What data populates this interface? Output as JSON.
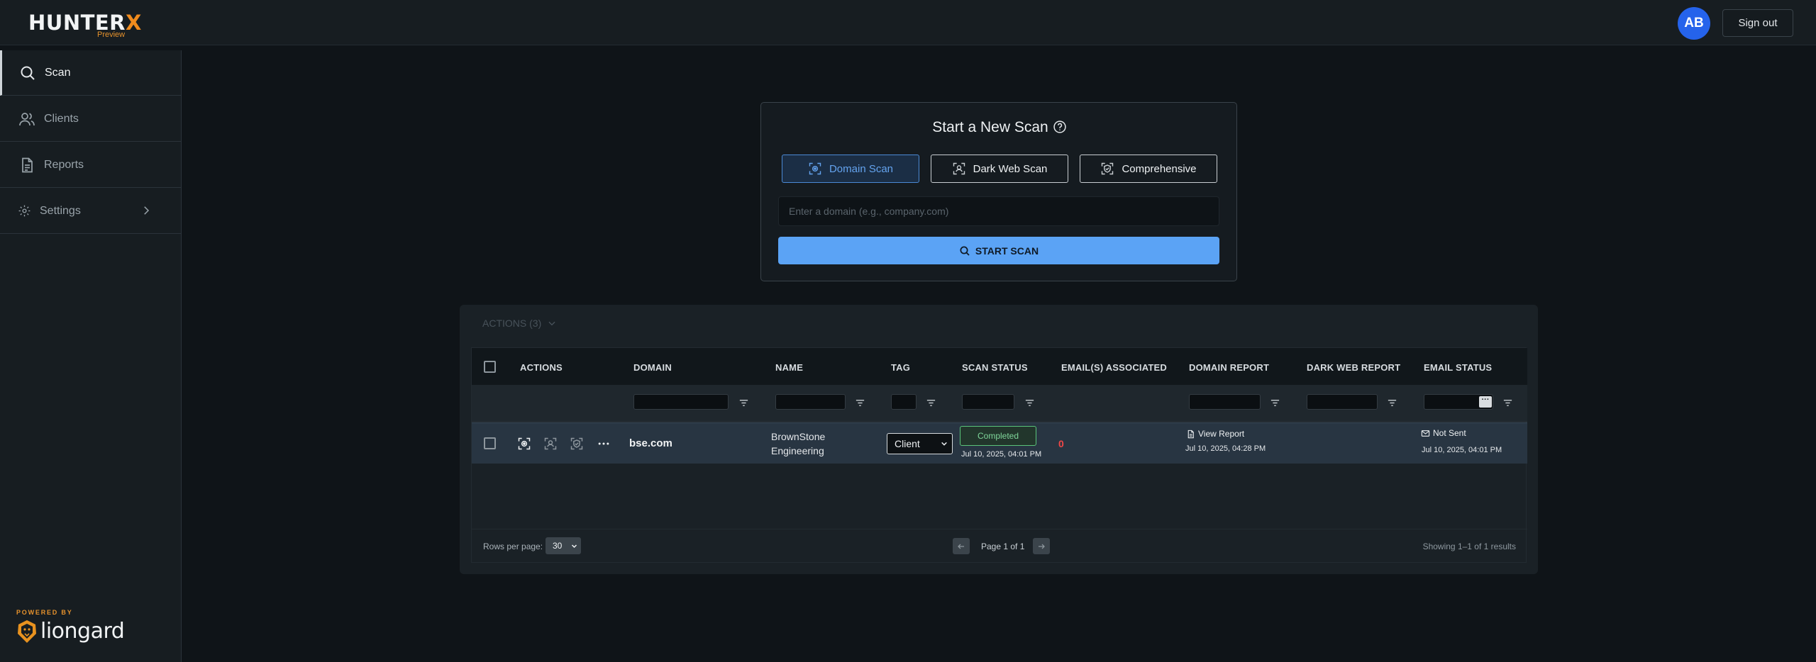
{
  "app": {
    "logo_main": "HUNTER",
    "logo_x": "X",
    "logo_sub": "Preview",
    "avatar_initials": "AB",
    "signout_label": "Sign out",
    "accent_color": "#5ba3f5",
    "brand_color": "#f08b1d"
  },
  "sidebar": {
    "items": [
      {
        "label": "Scan",
        "icon": "search-icon",
        "active": true
      },
      {
        "label": "Clients",
        "icon": "users-icon",
        "active": false
      },
      {
        "label": "Reports",
        "icon": "document-icon",
        "active": false
      },
      {
        "label": "Settings",
        "icon": "gear-icon",
        "active": false
      }
    ],
    "powered_by": "POWERED BY",
    "powered_brand": "liongard"
  },
  "scan": {
    "title": "Start a New Scan",
    "types": [
      {
        "label": "Domain Scan",
        "active": true
      },
      {
        "label": "Dark Web Scan",
        "active": false
      },
      {
        "label": "Comprehensive",
        "active": false
      }
    ],
    "input_placeholder": "Enter a domain (e.g., company.com)",
    "input_value": "",
    "start_label": "START SCAN"
  },
  "table": {
    "actions_menu": "ACTIONS (3)",
    "columns": [
      "ACTIONS",
      "DOMAIN",
      "NAME",
      "TAG",
      "SCAN STATUS",
      "EMAIL(S) ASSOCIATED",
      "DOMAIN REPORT",
      "DARK WEB REPORT",
      "EMAIL STATUS"
    ],
    "rows": [
      {
        "domain": "bse.com",
        "name_line1": "BrownStone",
        "name_line2": "Engineering",
        "tag": "Client",
        "scan_status": "Completed",
        "scan_date": "Jul 10, 2025, 04:01 PM",
        "emails_associated": "0",
        "domain_report_label": "View Report",
        "domain_report_date": "Jul 10, 2025, 04:28 PM",
        "dark_web_report": "",
        "email_status": "Not Sent",
        "email_status_date": "Jul 10, 2025, 04:01 PM"
      }
    ],
    "footer": {
      "rows_per_page_label": "Rows per page:",
      "rows_per_page_value": "30",
      "page_label": "Page 1 of 1",
      "results_label": "Showing 1–1 of 1 results"
    }
  }
}
